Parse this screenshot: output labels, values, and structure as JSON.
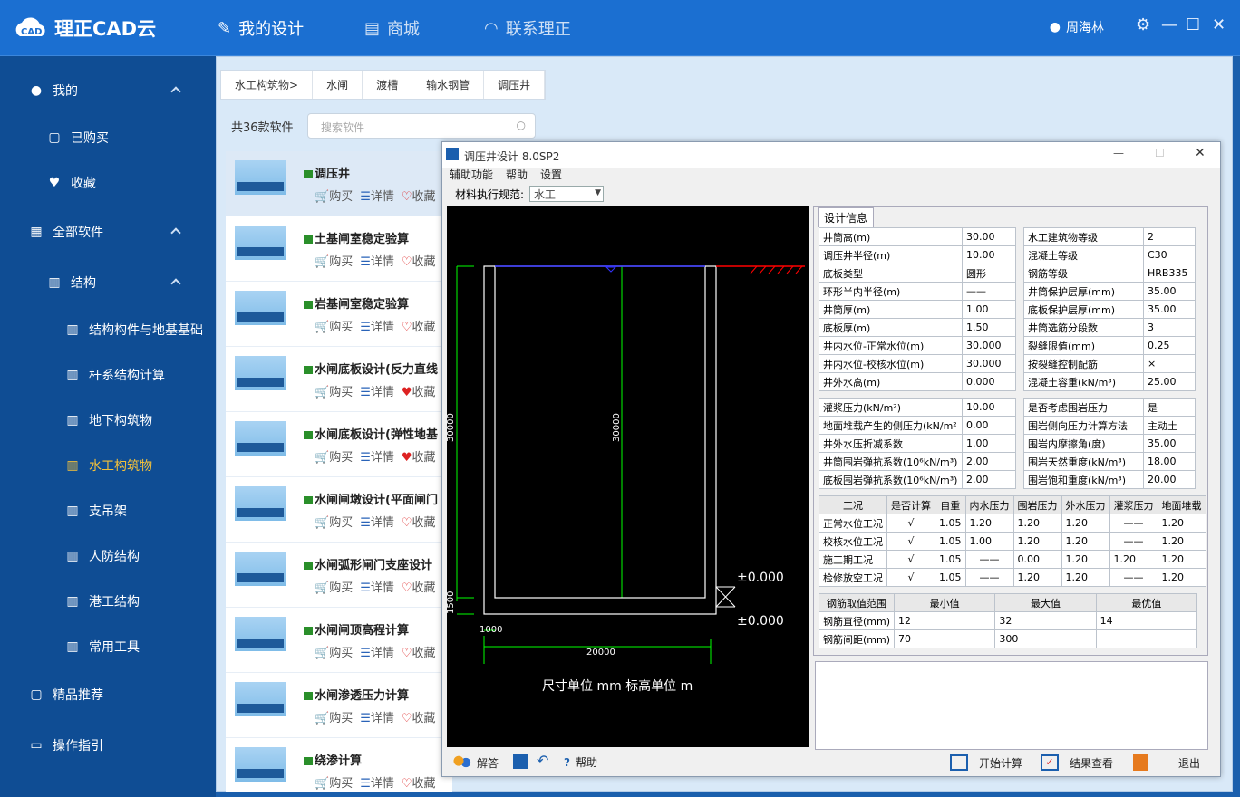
{
  "app": {
    "logo_text": "理正CAD云",
    "brand_color": "#1b6fd1",
    "sidebar_color": "#0f4d94"
  },
  "nav": [
    {
      "label": "我的设计",
      "icon": "pencil-ruler-icon"
    },
    {
      "label": "商城",
      "icon": "store-icon"
    },
    {
      "label": "联系理正",
      "icon": "headset-icon"
    }
  ],
  "user": {
    "name": "周海林"
  },
  "sidebar": {
    "my": "我的",
    "bought": "已购买",
    "fav": "收藏",
    "all": "全部软件",
    "struct": "结构",
    "cats": [
      "结构构件与地基基础",
      "杆系结构计算",
      "地下构筑物",
      "水工构筑物",
      "支吊架",
      "人防结构",
      "港工结构",
      "常用工具"
    ],
    "selected": "水工构筑物",
    "pick": "精品推荐",
    "guide": "操作指引"
  },
  "tabs": [
    "水工构筑物>",
    "水闸",
    "渡槽",
    "输水钢管",
    "调压井"
  ],
  "count_text": "共36款软件",
  "search_placeholder": "搜索软件",
  "products": [
    {
      "title": "调压井"
    },
    {
      "title": "土基闸室稳定验算"
    },
    {
      "title": "岩基闸室稳定验算"
    },
    {
      "title": "水闸底板设计(反力直线"
    },
    {
      "title": "水闸底板设计(弹性地基"
    },
    {
      "title": "水闸闸墩设计(平面闸门"
    },
    {
      "title": "水闸弧形闸门支座设计"
    },
    {
      "title": "水闸闸顶高程计算"
    },
    {
      "title": "水闸渗透压力计算"
    },
    {
      "title": "绕渗计算"
    }
  ],
  "actions": {
    "buy": "购买",
    "detail": "详情",
    "fav": "收藏"
  },
  "dialog": {
    "title": "调压井设计 8.0SP2",
    "menu": [
      "辅助功能",
      "帮助",
      "设置"
    ],
    "spec_label": "材料执行规范:",
    "spec_value": "水工",
    "design_tab": "设计信息",
    "cad": {
      "dim_left": "30000",
      "dim_inner": "30000",
      "dim_bot": "1500",
      "dim_w": "1000",
      "dim_total": "20000",
      "elev1": "±0.000",
      "elev2": "±0.000",
      "unit": "尺寸单位 mm  标高单位 m"
    },
    "g1_left": [
      [
        "井筒高(m)",
        "30.00"
      ],
      [
        "调压井半径(m)",
        "10.00"
      ],
      [
        "底板类型",
        "圆形"
      ],
      [
        "环形半内半径(m)",
        "——"
      ],
      [
        "井筒厚(m)",
        "1.00"
      ],
      [
        "底板厚(m)",
        "1.50"
      ],
      [
        "井内水位-正常水位(m)",
        "30.000"
      ],
      [
        "井内水位-校核水位(m)",
        "30.000"
      ],
      [
        "井外水高(m)",
        "0.000"
      ]
    ],
    "g1_right": [
      [
        "水工建筑物等级",
        "2"
      ],
      [
        "混凝土等级",
        "C30"
      ],
      [
        "钢筋等级",
        "HRB335"
      ],
      [
        "井筒保护层厚(mm)",
        "35.00"
      ],
      [
        "底板保护层厚(mm)",
        "35.00"
      ],
      [
        "井筒选筋分段数",
        "3"
      ],
      [
        "裂缝限值(mm)",
        "0.25"
      ],
      [
        "按裂缝控制配筋",
        "×"
      ],
      [
        "混凝土容重(kN/m³)",
        "25.00"
      ]
    ],
    "g2_left": [
      [
        "灌浆压力(kN/m²)",
        "10.00"
      ],
      [
        "地面堆载产生的侧压力(kN/m²",
        "0.00"
      ],
      [
        "井外水压折减系数",
        "1.00"
      ],
      [
        "井筒围岩弹抗系数(10⁶kN/m³)",
        "2.00"
      ],
      [
        "底板围岩弹抗系数(10⁶kN/m³)",
        "2.00"
      ]
    ],
    "g2_right": [
      [
        "是否考虑围岩压力",
        "是"
      ],
      [
        "围岩侧向压力计算方法",
        "主动土"
      ],
      [
        "围岩内摩擦角(度)",
        "35.00"
      ],
      [
        "围岩天然重度(kN/m³)",
        "18.00"
      ],
      [
        "围岩饱和重度(kN/m³)",
        "20.00"
      ]
    ],
    "cases_head": [
      "工况",
      "是否计算",
      "自重",
      "内水压力",
      "围岩压力",
      "外水压力",
      "灌浆压力",
      "地面堆载"
    ],
    "cases": [
      [
        "正常水位工况",
        "√",
        "1.05",
        "1.20",
        "1.20",
        "1.20",
        "——",
        "1.20"
      ],
      [
        "校核水位工况",
        "√",
        "1.05",
        "1.00",
        "1.20",
        "1.20",
        "——",
        "1.20"
      ],
      [
        "施工期工况",
        "√",
        "1.05",
        "——",
        "0.00",
        "1.20",
        "1.20",
        "1.20"
      ],
      [
        "检修放空工况",
        "√",
        "1.05",
        "——",
        "1.20",
        "1.20",
        "——",
        "1.20"
      ]
    ],
    "rebar_head": [
      "钢筋取值范围",
      "最小值",
      "最大值",
      "最优值"
    ],
    "rebar": [
      [
        "钢筋直径(mm)",
        "12",
        "32",
        "14"
      ],
      [
        "钢筋间距(mm)",
        "70",
        "300",
        ""
      ]
    ],
    "toolbar": {
      "answer": "解答",
      "help": "帮助",
      "start": "开始计算",
      "result": "结果查看",
      "exit": "退出"
    }
  }
}
